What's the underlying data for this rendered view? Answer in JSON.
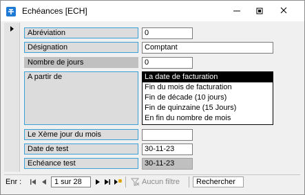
{
  "window": {
    "title": "Echéances [ECH]",
    "icons": {
      "app": "app-icon",
      "minimize": "minimize-icon",
      "restore": "restore-icon",
      "close": "close-icon"
    }
  },
  "form": {
    "abreviation": {
      "label": "Abréviation",
      "value": "0"
    },
    "designation": {
      "label": "Désignation",
      "value": "Comptant"
    },
    "nombre_jours": {
      "label": "Nombre de jours",
      "value": "0"
    },
    "a_partir_de": {
      "label": "A partir de",
      "options": [
        "La date de facturation",
        "Fin du mois de facturation",
        "Fin de décade (10 jours)",
        "Fin de quinzaine (15 Jours)",
        "En fin du nombre de mois"
      ],
      "selected_index": 0
    },
    "xeme_jour": {
      "label": "Le Xème jour du mois",
      "value": ""
    },
    "date_test": {
      "label": "Date de test",
      "value": "30-11-23"
    },
    "echeance_test": {
      "label": "Echéance test",
      "value": "30-11-23"
    }
  },
  "navigation": {
    "label": "Enr :",
    "record": "1 sur 28",
    "filter_label": "Aucun filtre",
    "search_label": "Rechercher"
  },
  "colors": {
    "selection": "#000000",
    "label_border": "#3a9fd6",
    "label_bg": "#dcdcdc",
    "app_icon": "#1f7ad4"
  }
}
